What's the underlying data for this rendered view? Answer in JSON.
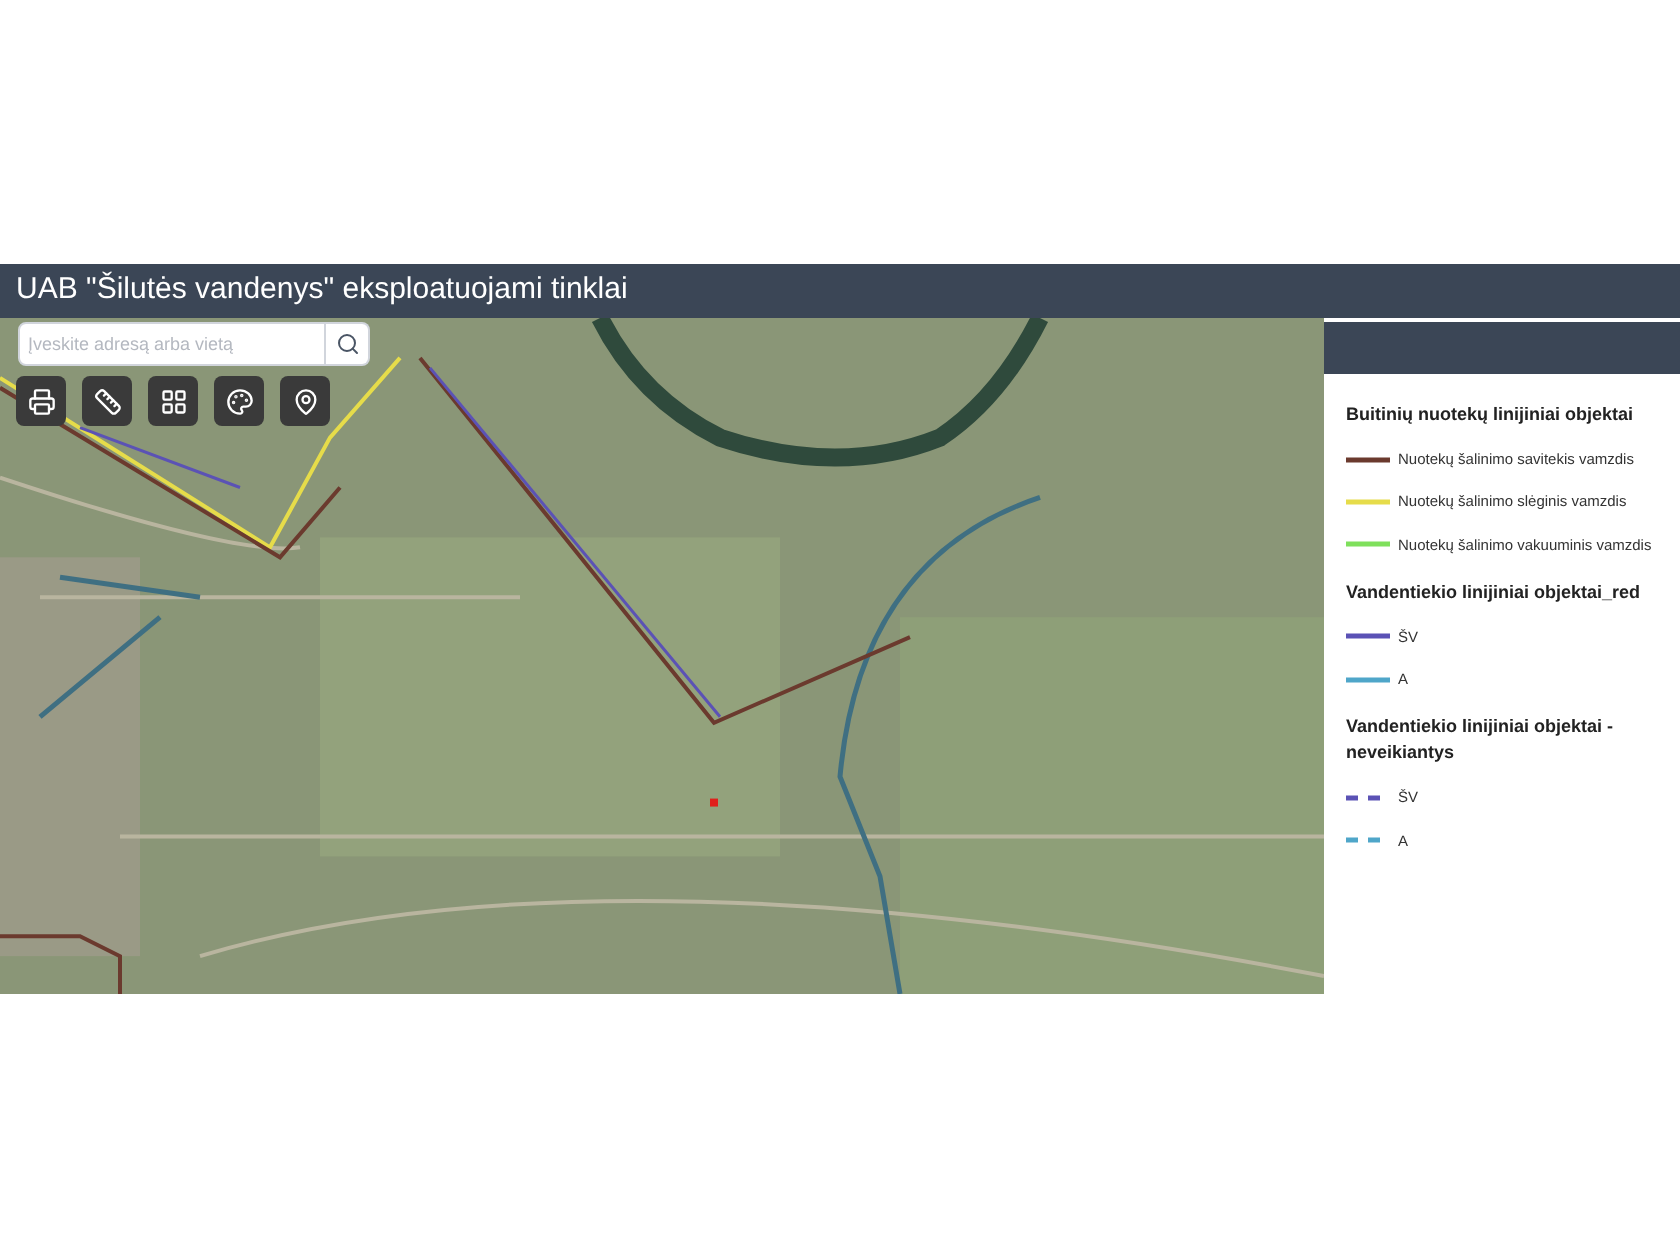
{
  "window": {
    "title": "UAB \"Šilutės vandenys\" eksploatuojami tinklai"
  },
  "search": {
    "placeholder": "Įveskite adresą arba vietą"
  },
  "legend": {
    "groups": [
      {
        "title": "Buitinių nuotekų linijiniai objektai",
        "items": [
          {
            "label": "Nuotekų šalinimo savitekis vamzdis",
            "kind": "solid",
            "color": "#6b3a2e"
          },
          {
            "label": "Nuotekų šalinimo slėginis vamzdis",
            "kind": "solid",
            "color": "#e6dc4a"
          },
          {
            "label": "Nuotekų šalinimo vakuuminis vamzdis",
            "kind": "solid",
            "color": "#7fe05c"
          }
        ]
      },
      {
        "title": "Vandentiekio linijiniai objektai_red",
        "items": [
          {
            "label": "ŠV",
            "kind": "solid",
            "color": "#5b52b5"
          },
          {
            "label": "A",
            "kind": "solid",
            "color": "#4fa6c9"
          }
        ]
      },
      {
        "title": "Vandentiekio linijiniai objektai - neveikiantys",
        "items": [
          {
            "label": "ŠV",
            "kind": "dashed",
            "color": "#5b52b5"
          },
          {
            "label": "A",
            "kind": "dashed",
            "color": "#4fa6c9"
          }
        ]
      }
    ]
  }
}
